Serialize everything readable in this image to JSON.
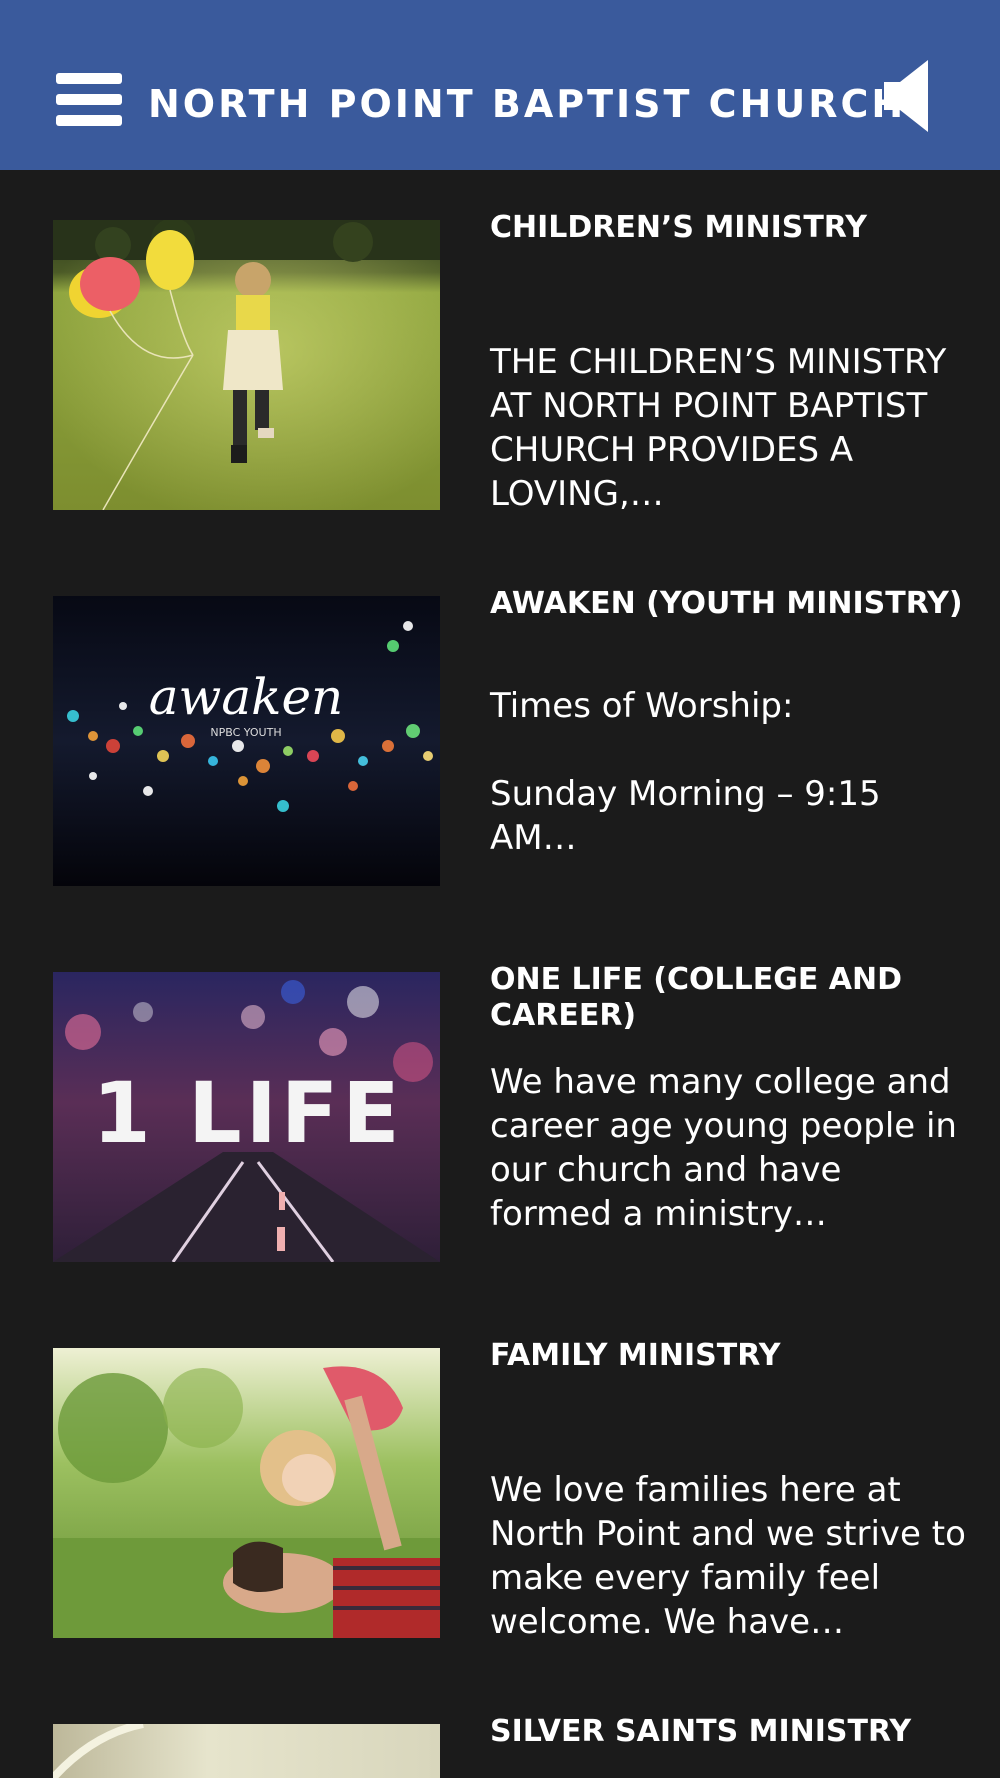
{
  "header": {
    "title": "NORTH POINT BAPTIST CHURCH",
    "menu_icon": "hamburger-menu-icon",
    "sound_icon": "speaker-icon",
    "background": "#3a5a9c"
  },
  "ministries": [
    {
      "title": "CHILDREN’S MINISTRY",
      "excerpt": "THE CHILDREN’S MINISTRY AT NORTH POINT BAPTIST CHURCH PROVIDES A LOVING,…"
    },
    {
      "title": "AWAKEN (YOUTH MINISTRY)",
      "excerpt_line1": "Times of Worship:",
      "excerpt_line2": "Sunday Morning – 9:15 AM…",
      "image_text": "awaken",
      "image_subtext": "NPBC YOUTH"
    },
    {
      "title": "ONE LIFE (COLLEGE AND CAREER)",
      "excerpt": "We have many college and career age young people in our church and have formed a ministry…",
      "image_text": "1 LIFE"
    },
    {
      "title": "FAMILY MINISTRY",
      "excerpt": "We love families here at North Point and we strive to make every family feel welcome. We have…"
    },
    {
      "title": "SILVER SAINTS MINISTRY"
    }
  ]
}
